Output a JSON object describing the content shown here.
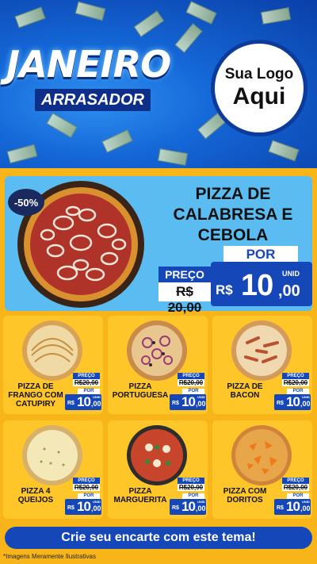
{
  "header": {
    "title_line1": "JANEIRO",
    "title_line2": "ARRASADOR",
    "logo_line1": "Sua Logo",
    "logo_line2": "Aqui"
  },
  "featured": {
    "discount": "-50%",
    "name": "PIZZA DE CALABRESA E CEBOLA",
    "por_label": "POR",
    "preco_label": "PREÇO",
    "old_price": "R$ 20,00",
    "currency": "R$",
    "price_int": "10",
    "price_cents": ",00",
    "unit": "UNID"
  },
  "products": [
    {
      "name": "PIZZA DE FRANGO COM CATUPIRY",
      "preco_label": "PREÇO",
      "old_price": "R$20,00",
      "por_label": "POR",
      "currency": "R$",
      "price_int": "10",
      "price_cents": ",00",
      "unit": "UNID"
    },
    {
      "name": "PIZZA PORTUGUESA",
      "preco_label": "PREÇO",
      "old_price": "R$20,00",
      "por_label": "POR",
      "currency": "R$",
      "price_int": "10",
      "price_cents": ",00",
      "unit": "UNID"
    },
    {
      "name": "PIZZA DE BACON",
      "preco_label": "PREÇO",
      "old_price": "R$20,00",
      "por_label": "POR",
      "currency": "R$",
      "price_int": "10",
      "price_cents": ",00",
      "unit": "UNID"
    },
    {
      "name": "PIZZA 4 QUEIJOS",
      "preco_label": "PREÇO",
      "old_price": "R$20,00",
      "por_label": "POR",
      "currency": "R$",
      "price_int": "10",
      "price_cents": ",00",
      "unit": "UNID"
    },
    {
      "name": "PIZZA MARGUERITA",
      "preco_label": "PREÇO",
      "old_price": "R$20,00",
      "por_label": "POR",
      "currency": "R$",
      "price_int": "10",
      "price_cents": ",00",
      "unit": "UNID"
    },
    {
      "name": "PIZZA COM DORITOS",
      "preco_label": "PREÇO",
      "old_price": "R$20,00",
      "por_label": "POR",
      "currency": "R$",
      "price_int": "10",
      "price_cents": ",00",
      "unit": "UNID"
    }
  ],
  "footer": {
    "cta": "Crie seu encarte com este tema!",
    "disclaimer": "*Imagens Meramente Ilustrativas"
  },
  "colors": {
    "background": "#f7b51a",
    "brand_blue": "#1547b8",
    "featured_panel": "#5bbcf2",
    "card": "#ffc62a"
  },
  "icons": {
    "money_bills": "banknote-icon",
    "pizza": "pizza-icon"
  }
}
